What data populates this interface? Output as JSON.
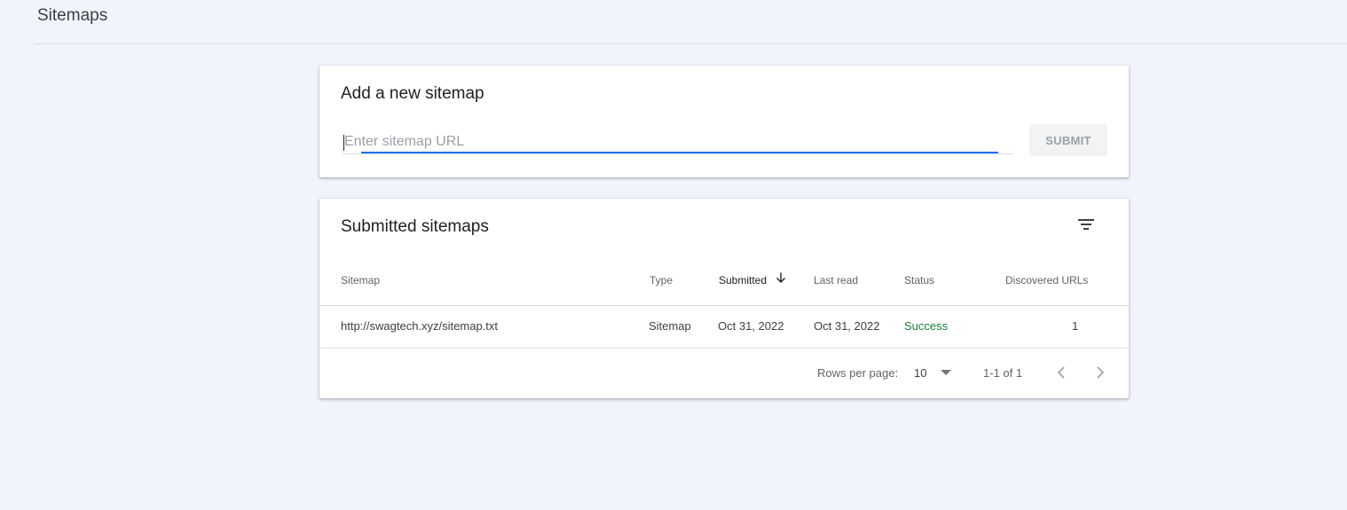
{
  "page": {
    "title": "Sitemaps"
  },
  "add_sitemap": {
    "title": "Add a new sitemap",
    "input_value": "",
    "input_placeholder": "Enter sitemap URL",
    "submit_label": "SUBMIT"
  },
  "submitted_sitemaps": {
    "title": "Submitted sitemaps",
    "filter_icon": "filter-list-icon",
    "sort_icon": "arrow-downward-icon",
    "columns": {
      "sitemap": "Sitemap",
      "type": "Type",
      "submitted": "Submitted",
      "last_read": "Last read",
      "status": "Status",
      "discovered_urls": "Discovered URLs"
    },
    "rows": [
      {
        "sitemap": "http://swagtech.xyz/sitemap.txt",
        "type": "Sitemap",
        "submitted": "Oct 31, 2022",
        "last_read": "Oct 31, 2022",
        "status": "Success",
        "discovered_urls": "1"
      }
    ],
    "pagination": {
      "rows_per_page_label": "Rows per page:",
      "rows_per_page_value": "10",
      "range": "1-1 of 1",
      "prev_icon": "chevron-left-icon",
      "next_icon": "chevron-right-icon"
    }
  },
  "colors": {
    "background": "#f1f4fb",
    "accent": "#1a73e8",
    "success": "#188038"
  }
}
